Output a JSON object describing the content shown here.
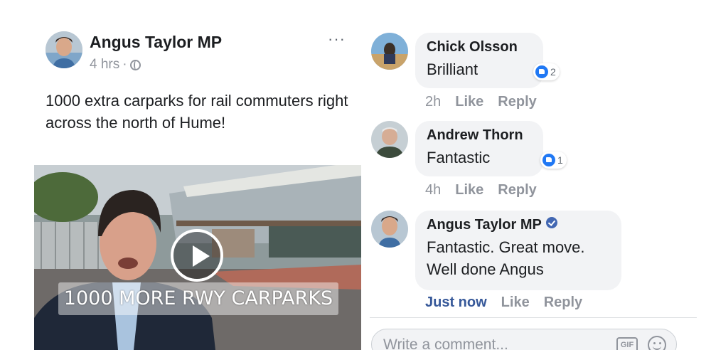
{
  "post": {
    "author": "Angus Taylor MP",
    "time": "4 hrs",
    "separator": "·",
    "more_label": "···",
    "text": "1000 extra carparks for rail commuters right across the north of Hume!",
    "video": {
      "caption": "1000 MORE RWY CARPARKS"
    }
  },
  "comments": [
    {
      "author": "Chick Olsson",
      "text": "Brilliant",
      "reactions": "2",
      "time": "2h",
      "like_label": "Like",
      "reply_label": "Reply"
    },
    {
      "author": "Andrew Thorn",
      "text": "Fantastic",
      "reactions": "1",
      "time": "4h",
      "like_label": "Like",
      "reply_label": "Reply"
    },
    {
      "author": "Angus Taylor MP",
      "text_line1": "Fantastic. Great move.",
      "text_line2": "Well done Angus",
      "time": "Just now",
      "like_label": "Like",
      "reply_label": "Reply"
    }
  ],
  "composer": {
    "placeholder": "Write a comment...",
    "gif_label": "GIF"
  },
  "colors": {
    "link_blue": "#365899",
    "like_blue": "#2078f4",
    "muted": "#90949c",
    "bubble": "#f2f3f5"
  },
  "icons": [
    "globe-icon",
    "more-options-icon",
    "play-icon",
    "like-reaction-icon",
    "verified-badge-icon",
    "gif-icon",
    "emoji-icon"
  ]
}
